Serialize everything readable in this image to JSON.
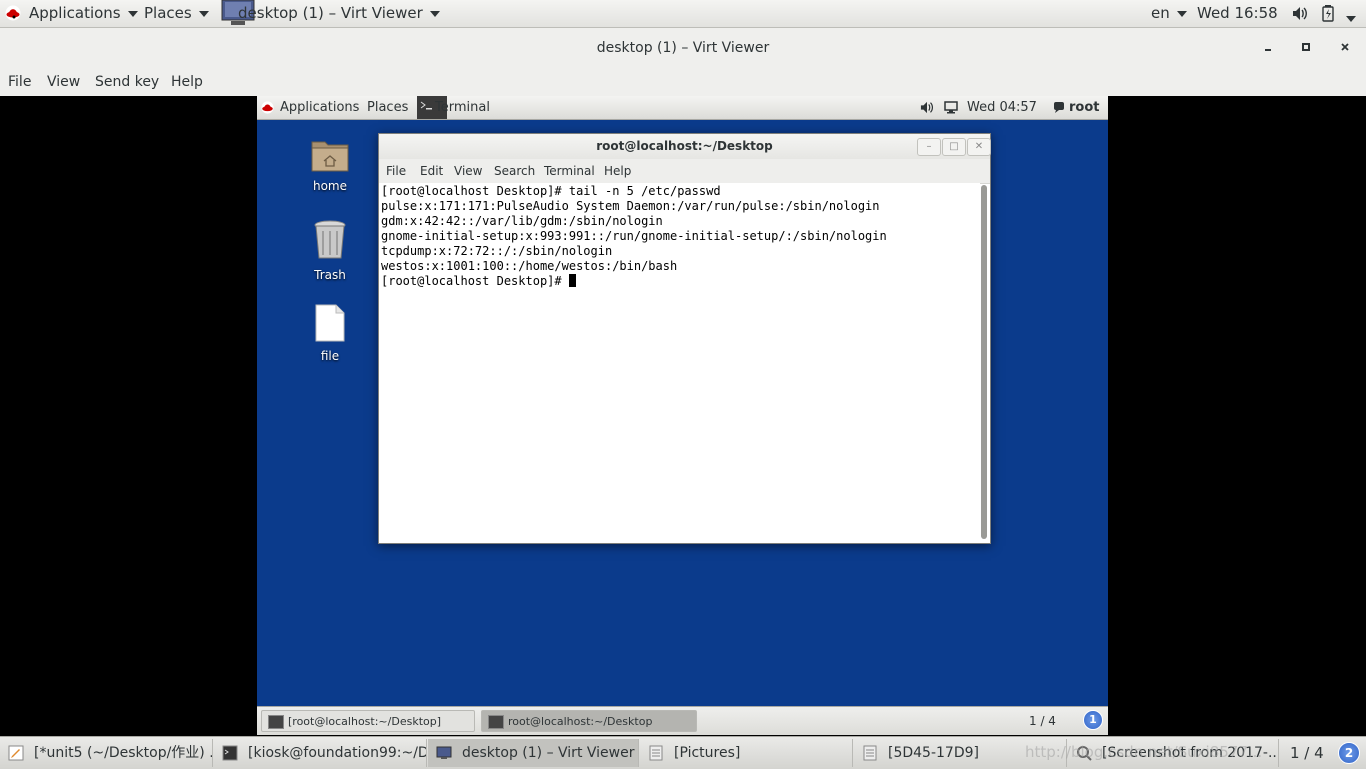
{
  "host_panel": {
    "applications": "Applications",
    "places": "Places",
    "window_item": "desktop (1) – Virt Viewer",
    "language": "en",
    "clock": "Wed 16:58"
  },
  "viewer": {
    "title": "desktop (1) – Virt Viewer",
    "menu": [
      "File",
      "View",
      "Send key",
      "Help"
    ]
  },
  "guest_panel": {
    "applications": "Applications",
    "places": "Places",
    "terminal": "Terminal",
    "clock": "Wed 04:57",
    "user": "root"
  },
  "desktop_icons": [
    {
      "label": "home"
    },
    {
      "label": "Trash"
    },
    {
      "label": "file"
    }
  ],
  "terminal": {
    "title": "root@localhost:~/Desktop",
    "menu": [
      "File",
      "Edit",
      "View",
      "Search",
      "Terminal",
      "Help"
    ],
    "lines": [
      "[root@localhost Desktop]# tail -n 5 /etc/passwd",
      "pulse:x:171:171:PulseAudio System Daemon:/var/run/pulse:/sbin/nologin",
      "gdm:x:42:42::/var/lib/gdm:/sbin/nologin",
      "gnome-initial-setup:x:993:991::/run/gnome-initial-setup/:/sbin/nologin",
      "tcpdump:x:72:72::/:/sbin/nologin",
      "westos:x:1001:100::/home/westos:/bin/bash"
    ],
    "prompt": "[root@localhost Desktop]# "
  },
  "guest_taskbar": {
    "tasks": [
      "[root@localhost:~/Desktop]",
      "root@localhost:~/Desktop"
    ],
    "workspace": "1 / 4",
    "badge": "1"
  },
  "host_taskbar": {
    "tasks": [
      "[*unit5 (~/Desktop/作业) ...",
      "[kiosk@foundation99:~/D...",
      "desktop (1) – Virt Viewer",
      "[Pictures]",
      "[5D45-17D9]",
      "[Screenshot from 2017-..."
    ],
    "workspace": "1 / 4",
    "badge": "2",
    "watermark": "http://blog.csdn.net/Suxi8577..."
  }
}
